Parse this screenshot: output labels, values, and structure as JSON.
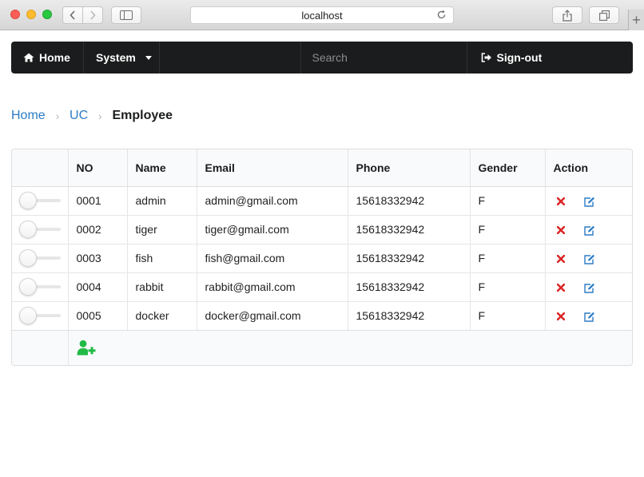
{
  "browser": {
    "url": "localhost"
  },
  "nav": {
    "home": "Home",
    "system": "System",
    "search_placeholder": "Search",
    "signout": "Sign-out"
  },
  "breadcrumb": {
    "items": [
      "Home",
      "UC"
    ],
    "active": "Employee"
  },
  "table": {
    "headers": [
      "NO",
      "Name",
      "Email",
      "Phone",
      "Gender",
      "Action"
    ],
    "rows": [
      {
        "no": "0001",
        "name": "admin",
        "email": "admin@gmail.com",
        "phone": "15618332942",
        "gender": "F",
        "selected": false
      },
      {
        "no": "0002",
        "name": "tiger",
        "email": "tiger@gmail.com",
        "phone": "15618332942",
        "gender": "F",
        "selected": false
      },
      {
        "no": "0003",
        "name": "fish",
        "email": "fish@gmail.com",
        "phone": "15618332942",
        "gender": "F",
        "selected": false
      },
      {
        "no": "0004",
        "name": "rabbit",
        "email": "rabbit@gmail.com",
        "phone": "15618332942",
        "gender": "F",
        "selected": false
      },
      {
        "no": "0005",
        "name": "docker",
        "email": "docker@gmail.com",
        "phone": "15618332942",
        "gender": "F",
        "selected": false
      }
    ]
  },
  "icons": {
    "home": "home-icon",
    "search": "search-icon",
    "signout": "sign-out-icon",
    "delete": "delete-icon",
    "edit": "edit-icon",
    "add_user": "add-user-icon"
  },
  "colors": {
    "navbar": "#1b1c1d",
    "link": "#2c7cc5",
    "delete": "#db2828",
    "edit": "#2c7cc5",
    "add": "#21ba45"
  }
}
